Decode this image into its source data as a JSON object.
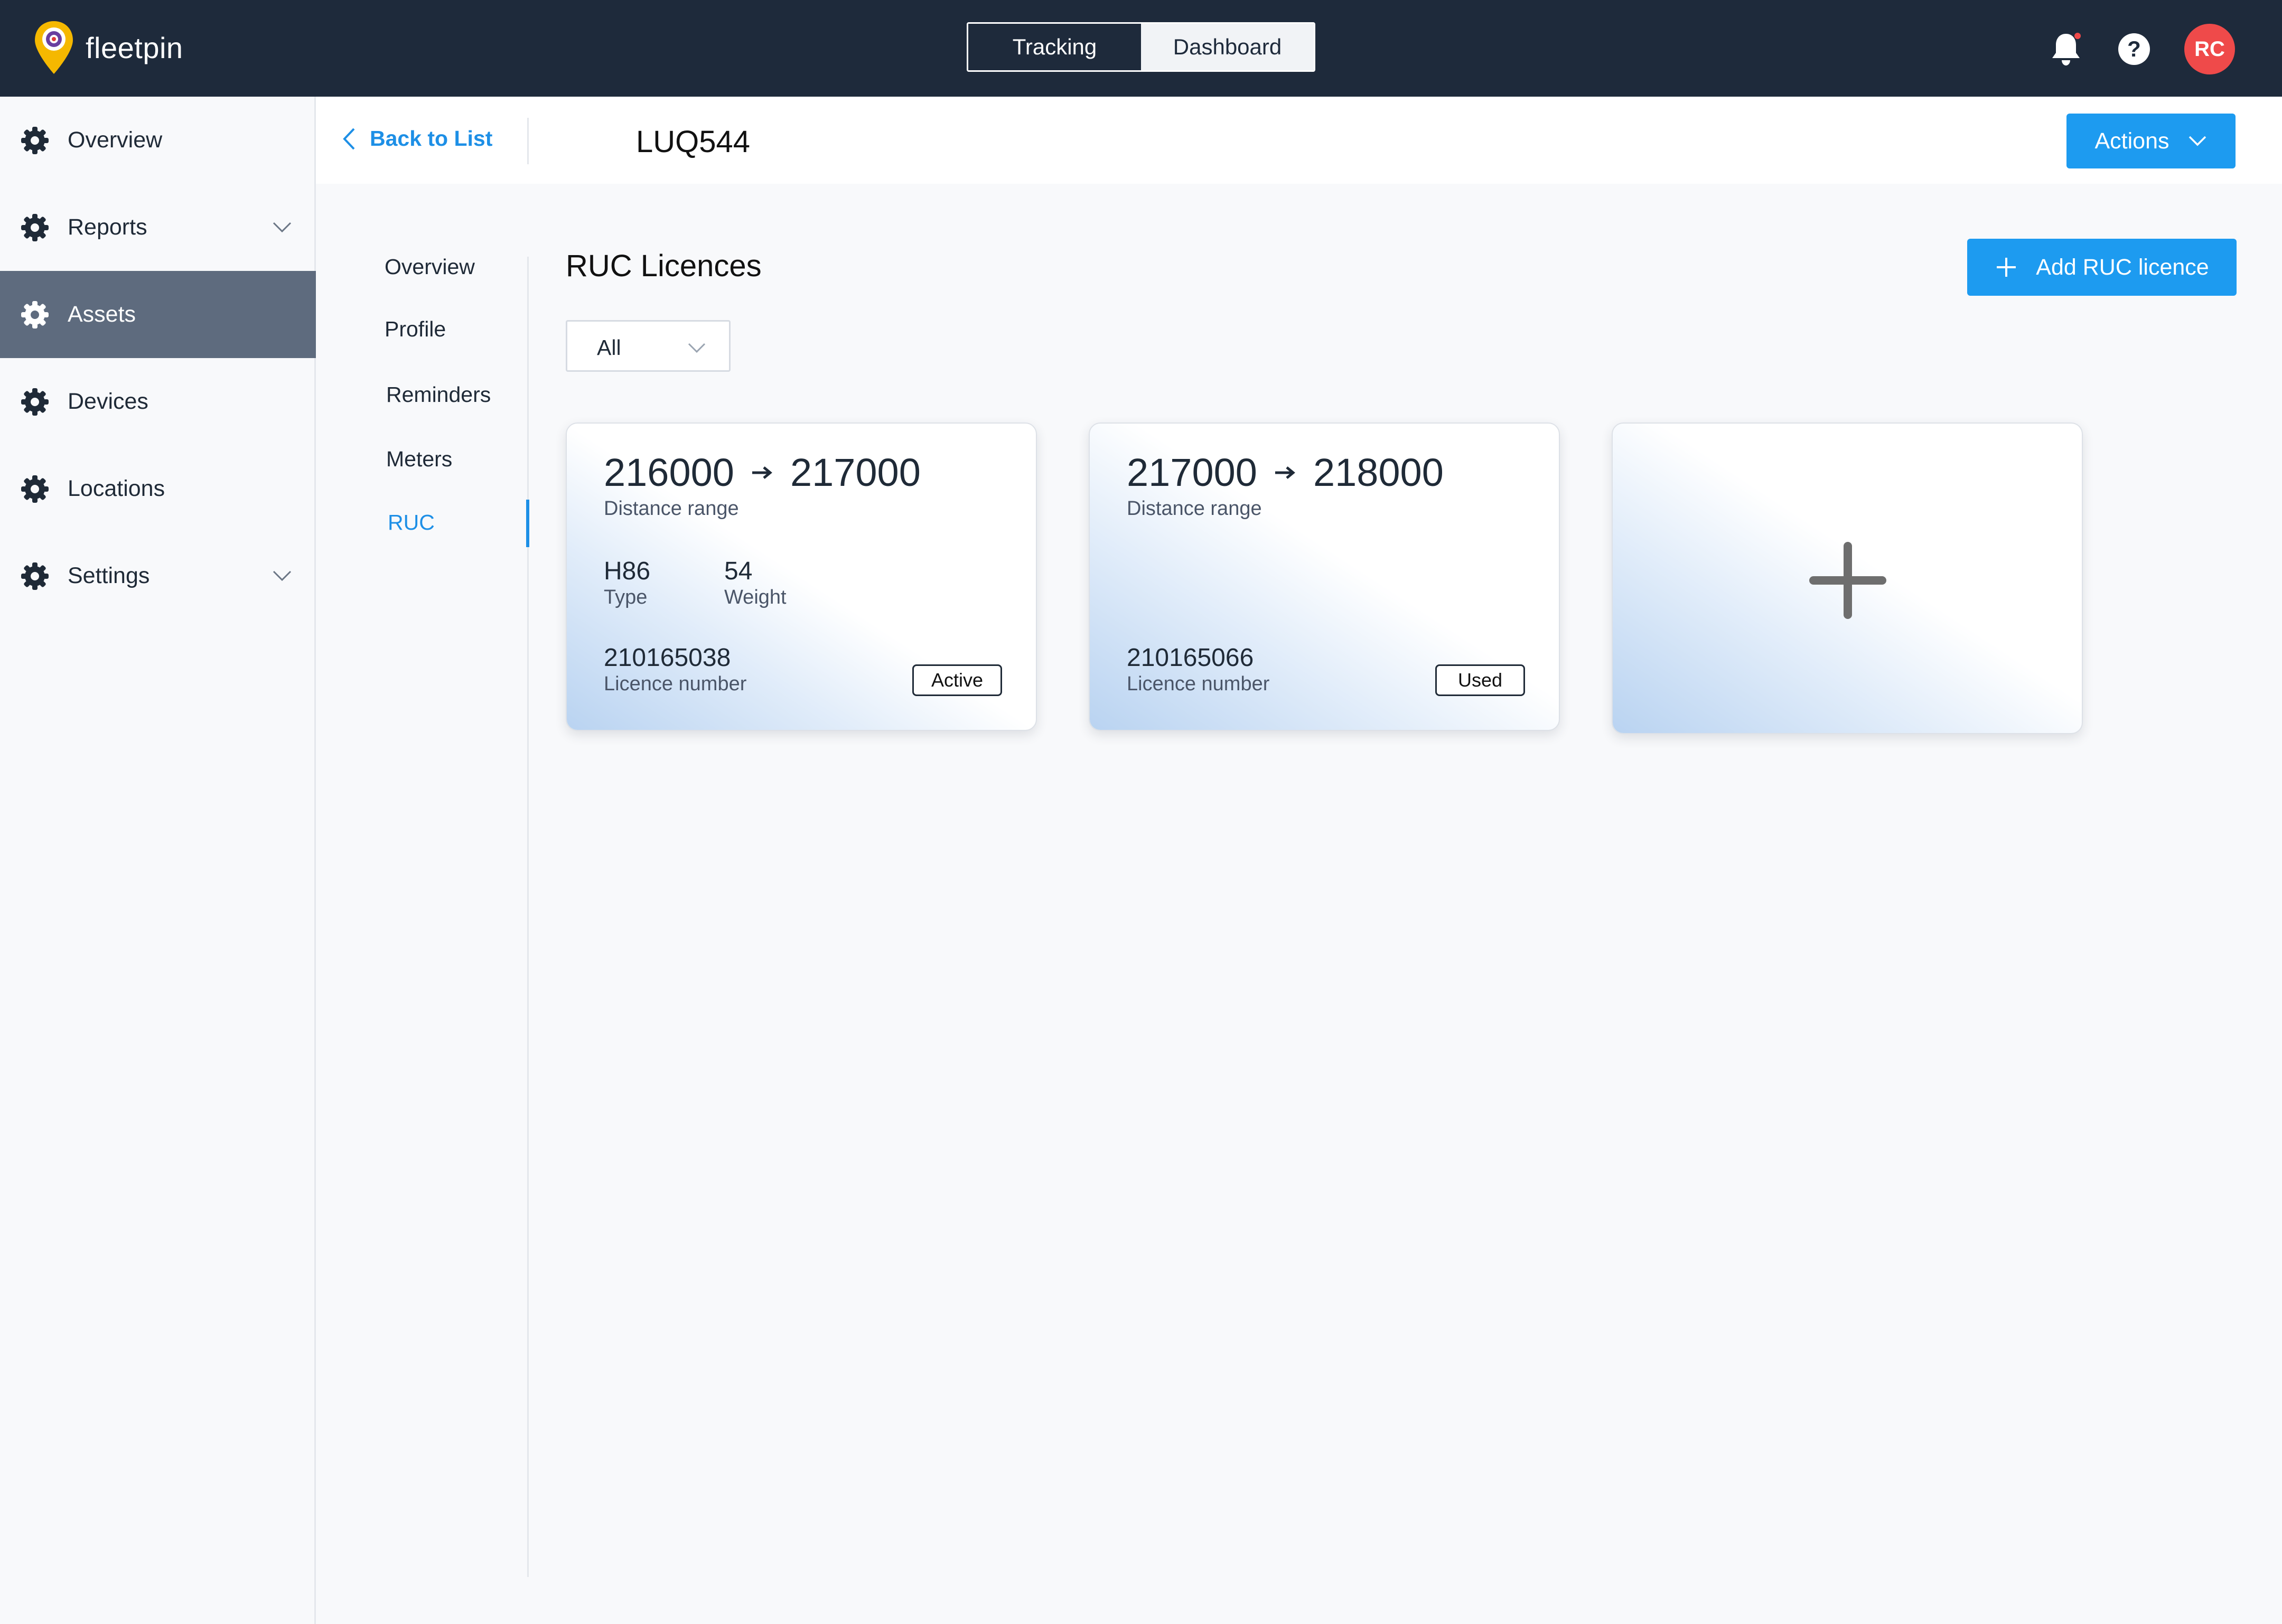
{
  "app": {
    "brand": "fleetpin",
    "toggle": {
      "tracking": "Tracking",
      "dashboard": "Dashboard"
    },
    "help_label": "?",
    "user_initials": "RC",
    "colors": {
      "topbar": "#1e2a3b",
      "accent": "#1d9bf0",
      "avatar": "#ef4a4a",
      "selected": "#5e6b7e"
    }
  },
  "sidebar": {
    "items": [
      {
        "label": "Overview",
        "icon": "gear-icon"
      },
      {
        "label": "Reports",
        "icon": "gear-icon",
        "expandable": true
      },
      {
        "label": "Assets",
        "icon": "gear-icon",
        "selected": true
      },
      {
        "label": "Devices",
        "icon": "gear-icon"
      },
      {
        "label": "Locations",
        "icon": "gear-icon"
      },
      {
        "label": "Settings",
        "icon": "gear-icon",
        "expandable": true
      }
    ]
  },
  "header": {
    "back_label": "Back to List",
    "asset_name": "LUQ544",
    "actions_label": "Actions"
  },
  "subnav": {
    "items": [
      "Overview",
      "Profile",
      "Reminders",
      "Meters",
      "RUC"
    ],
    "current": "RUC"
  },
  "content": {
    "title": "RUC Licences",
    "add_button": "Add RUC licence",
    "filter_value": "All",
    "cards": [
      {
        "start": "216000",
        "end": "217000",
        "range_label": "Distance range",
        "type_value": "H86",
        "type_label": "Type",
        "weight_value": "54",
        "weight_label": "Weight",
        "licence_number": "210165038",
        "licence_label": "Licence number",
        "status": "Active"
      },
      {
        "start": "217000",
        "end": "218000",
        "range_label": "Distance range",
        "licence_number": "210165066",
        "licence_label": "Licence number",
        "status": "Used"
      }
    ]
  }
}
